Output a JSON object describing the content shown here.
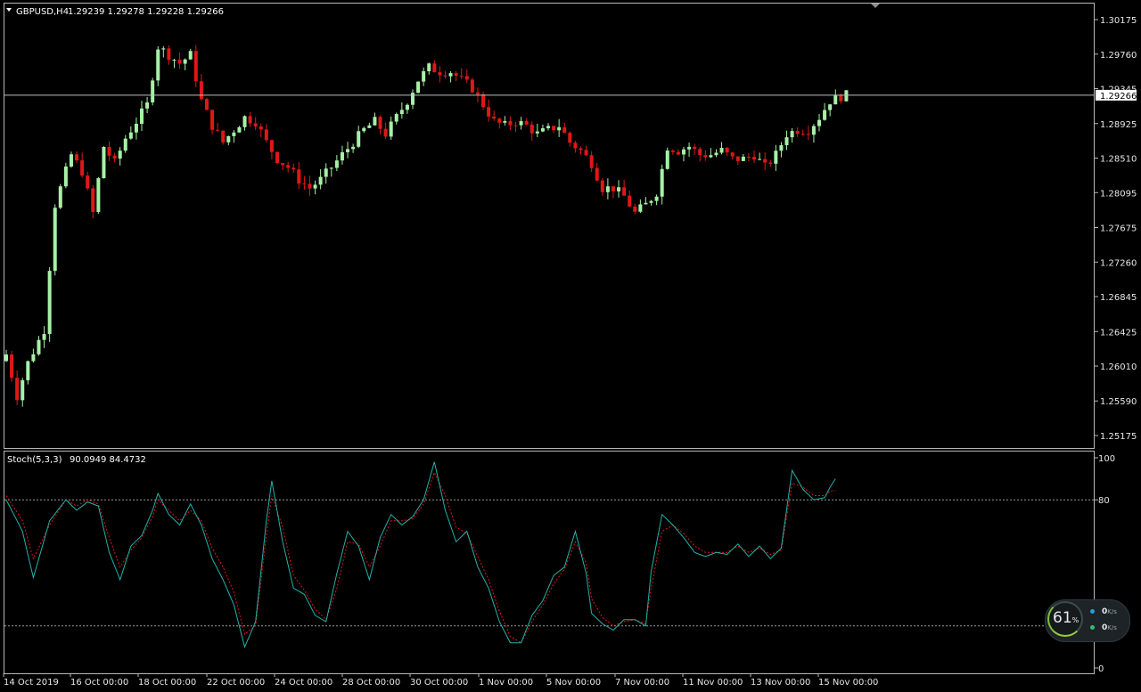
{
  "header": {
    "symbol_timeframe": "GBPUSD,H4",
    "ohlc": "1.29239 1.29278 1.29228 1.29266"
  },
  "indicator_header": {
    "name_params": "Stoch(5,3,3)",
    "values": "90.0949 84.4732"
  },
  "colors": {
    "bull": "#a6f1a6",
    "bear": "#e01717",
    "main_line": "#20b2aa",
    "signal_line": "#e01717",
    "bid_line": "#c0c0c0",
    "background": "#000000"
  },
  "net_widget": {
    "percent": "61",
    "percent_unit": "%",
    "upload": "0",
    "download": "0",
    "unit": "K/s"
  },
  "chart_data": [
    {
      "type": "candlestick",
      "title": "GBPUSD,H4",
      "price_ticks": [
        "1.30175",
        "1.29760",
        "1.29345",
        "1.28925",
        "1.28510",
        "1.28095",
        "1.27675",
        "1.27260",
        "1.26845",
        "1.26425",
        "1.26010",
        "1.25590",
        "1.25175"
      ],
      "price_tick_values": [
        1.30175,
        1.2976,
        1.29345,
        1.28925,
        1.2851,
        1.28095,
        1.27675,
        1.2726,
        1.26845,
        1.26425,
        1.2601,
        1.2559,
        1.25175
      ],
      "current_price": "1.29266",
      "time_labels": [
        "14 Oct 2019",
        "16 Oct 00:00",
        "18 Oct 00:00",
        "22 Oct 00:00",
        "24 Oct 00:00",
        "28 Oct 00:00",
        "30 Oct 00:00",
        "1 Nov 00:00",
        "5 Nov 00:00",
        "7 Nov 00:00",
        "11 Nov 00:00",
        "13 Nov 00:00",
        "15 Nov 00:00"
      ],
      "anchors": [
        [
          0,
          1.2615
        ],
        [
          2,
          1.2565
        ],
        [
          4,
          1.2605
        ],
        [
          7,
          1.2645
        ],
        [
          9,
          1.2795
        ],
        [
          12,
          1.2855
        ],
        [
          14,
          1.2835
        ],
        [
          16,
          1.2785
        ],
        [
          18,
          1.2865
        ],
        [
          20,
          1.2845
        ],
        [
          22,
          1.2875
        ],
        [
          24,
          1.2895
        ],
        [
          26,
          1.2915
        ],
        [
          28,
          1.2985
        ],
        [
          30,
          1.2975
        ],
        [
          32,
          1.2965
        ],
        [
          34,
          1.2975
        ],
        [
          36,
          1.292
        ],
        [
          38,
          1.289
        ],
        [
          40,
          1.287
        ],
        [
          42,
          1.2885
        ],
        [
          44,
          1.29
        ],
        [
          46,
          1.2895
        ],
        [
          48,
          1.287
        ],
        [
          50,
          1.285
        ],
        [
          52,
          1.284
        ],
        [
          54,
          1.2825
        ],
        [
          56,
          1.2815
        ],
        [
          58,
          1.2825
        ],
        [
          60,
          1.284
        ],
        [
          62,
          1.2855
        ],
        [
          64,
          1.287
        ],
        [
          66,
          1.2885
        ],
        [
          68,
          1.2895
        ],
        [
          70,
          1.288
        ],
        [
          72,
          1.29
        ],
        [
          74,
          1.292
        ],
        [
          76,
          1.2945
        ],
        [
          78,
          1.296
        ],
        [
          80,
          1.2955
        ],
        [
          82,
          1.2955
        ],
        [
          84,
          1.2945
        ],
        [
          86,
          1.2935
        ],
        [
          88,
          1.2915
        ],
        [
          90,
          1.2895
        ],
        [
          92,
          1.289
        ],
        [
          94,
          1.2895
        ],
        [
          96,
          1.289
        ],
        [
          98,
          1.288
        ],
        [
          100,
          1.2885
        ],
        [
          102,
          1.289
        ],
        [
          104,
          1.287
        ],
        [
          106,
          1.286
        ],
        [
          108,
          1.2845
        ],
        [
          110,
          1.2815
        ],
        [
          112,
          1.2815
        ],
        [
          114,
          1.2805
        ],
        [
          116,
          1.2785
        ],
        [
          118,
          1.2795
        ],
        [
          120,
          1.281
        ],
        [
          122,
          1.2865
        ],
        [
          124,
          1.286
        ],
        [
          126,
          1.2865
        ],
        [
          128,
          1.2855
        ],
        [
          130,
          1.2855
        ],
        [
          132,
          1.286
        ],
        [
          134,
          1.285
        ],
        [
          136,
          1.285
        ],
        [
          138,
          1.2855
        ],
        [
          140,
          1.284
        ],
        [
          142,
          1.2855
        ],
        [
          144,
          1.288
        ],
        [
          146,
          1.2885
        ],
        [
          148,
          1.2885
        ],
        [
          150,
          1.29
        ],
        [
          152,
          1.292
        ],
        [
          154,
          1.2925
        ],
        [
          155,
          1.29266
        ]
      ]
    },
    {
      "type": "line",
      "title": "Stoch(5,3,3)",
      "y_ticks": [
        "100",
        "80",
        "0"
      ],
      "levels": [
        80,
        20
      ],
      "ylim": [
        0,
        100
      ],
      "main_anchors": [
        [
          0,
          80
        ],
        [
          3,
          65
        ],
        [
          5,
          43
        ],
        [
          8,
          70
        ],
        [
          11,
          80
        ],
        [
          13,
          75
        ],
        [
          15,
          79
        ],
        [
          17,
          77
        ],
        [
          19,
          55
        ],
        [
          21,
          42
        ],
        [
          23,
          58
        ],
        [
          25,
          63
        ],
        [
          27,
          75
        ],
        [
          28,
          83
        ],
        [
          30,
          73
        ],
        [
          32,
          68
        ],
        [
          34,
          78
        ],
        [
          36,
          68
        ],
        [
          38,
          52
        ],
        [
          40,
          42
        ],
        [
          42,
          30
        ],
        [
          44,
          10
        ],
        [
          46,
          22
        ],
        [
          48,
          70
        ],
        [
          49,
          89
        ],
        [
          51,
          60
        ],
        [
          53,
          38
        ],
        [
          55,
          35
        ],
        [
          57,
          25
        ],
        [
          59,
          22
        ],
        [
          61,
          45
        ],
        [
          63,
          65
        ],
        [
          65,
          58
        ],
        [
          67,
          42
        ],
        [
          69,
          62
        ],
        [
          71,
          73
        ],
        [
          73,
          68
        ],
        [
          75,
          72
        ],
        [
          77,
          80
        ],
        [
          79,
          98
        ],
        [
          81,
          75
        ],
        [
          83,
          60
        ],
        [
          85,
          65
        ],
        [
          87,
          48
        ],
        [
          89,
          38
        ],
        [
          91,
          22
        ],
        [
          93,
          12
        ],
        [
          95,
          12
        ],
        [
          97,
          25
        ],
        [
          99,
          32
        ],
        [
          101,
          44
        ],
        [
          103,
          48
        ],
        [
          105,
          65
        ],
        [
          107,
          45
        ],
        [
          108,
          26
        ],
        [
          110,
          21
        ],
        [
          112,
          18
        ],
        [
          114,
          23
        ],
        [
          116,
          23
        ],
        [
          118,
          20
        ],
        [
          119,
          46
        ],
        [
          121,
          73
        ],
        [
          123,
          68
        ],
        [
          125,
          62
        ],
        [
          127,
          55
        ],
        [
          129,
          53
        ],
        [
          131,
          55
        ],
        [
          133,
          54
        ],
        [
          135,
          59
        ],
        [
          137,
          53
        ],
        [
          139,
          58
        ],
        [
          141,
          52
        ],
        [
          143,
          57
        ],
        [
          145,
          94
        ],
        [
          147,
          85
        ],
        [
          149,
          80
        ],
        [
          151,
          81
        ],
        [
          152,
          86
        ],
        [
          153,
          90
        ]
      ],
      "signal_anchors": [
        [
          0,
          82
        ],
        [
          3,
          70
        ],
        [
          5,
          52
        ],
        [
          8,
          68
        ],
        [
          11,
          80
        ],
        [
          13,
          77
        ],
        [
          15,
          80
        ],
        [
          17,
          78
        ],
        [
          19,
          62
        ],
        [
          21,
          48
        ],
        [
          23,
          56
        ],
        [
          25,
          62
        ],
        [
          27,
          72
        ],
        [
          28,
          80
        ],
        [
          30,
          75
        ],
        [
          32,
          70
        ],
        [
          34,
          75
        ],
        [
          36,
          70
        ],
        [
          38,
          57
        ],
        [
          40,
          48
        ],
        [
          42,
          36
        ],
        [
          44,
          16
        ],
        [
          46,
          20
        ],
        [
          48,
          63
        ],
        [
          49,
          82
        ],
        [
          51,
          67
        ],
        [
          53,
          44
        ],
        [
          55,
          37
        ],
        [
          57,
          28
        ],
        [
          59,
          23
        ],
        [
          61,
          38
        ],
        [
          63,
          60
        ],
        [
          65,
          59
        ],
        [
          67,
          48
        ],
        [
          69,
          58
        ],
        [
          71,
          70
        ],
        [
          73,
          70
        ],
        [
          75,
          71
        ],
        [
          77,
          78
        ],
        [
          79,
          93
        ],
        [
          81,
          82
        ],
        [
          83,
          67
        ],
        [
          85,
          64
        ],
        [
          87,
          53
        ],
        [
          89,
          42
        ],
        [
          91,
          27
        ],
        [
          93,
          15
        ],
        [
          95,
          12
        ],
        [
          97,
          22
        ],
        [
          99,
          30
        ],
        [
          101,
          40
        ],
        [
          103,
          47
        ],
        [
          105,
          60
        ],
        [
          107,
          50
        ],
        [
          108,
          33
        ],
        [
          110,
          24
        ],
        [
          112,
          20
        ],
        [
          114,
          22
        ],
        [
          116,
          23
        ],
        [
          118,
          21
        ],
        [
          119,
          38
        ],
        [
          121,
          65
        ],
        [
          123,
          68
        ],
        [
          125,
          64
        ],
        [
          127,
          58
        ],
        [
          129,
          55
        ],
        [
          131,
          55
        ],
        [
          133,
          55
        ],
        [
          135,
          58
        ],
        [
          137,
          55
        ],
        [
          139,
          57
        ],
        [
          141,
          54
        ],
        [
          143,
          56
        ],
        [
          145,
          88
        ],
        [
          147,
          86
        ],
        [
          149,
          82
        ],
        [
          151,
          82
        ],
        [
          152,
          84
        ],
        [
          153,
          84.5
        ]
      ]
    }
  ]
}
